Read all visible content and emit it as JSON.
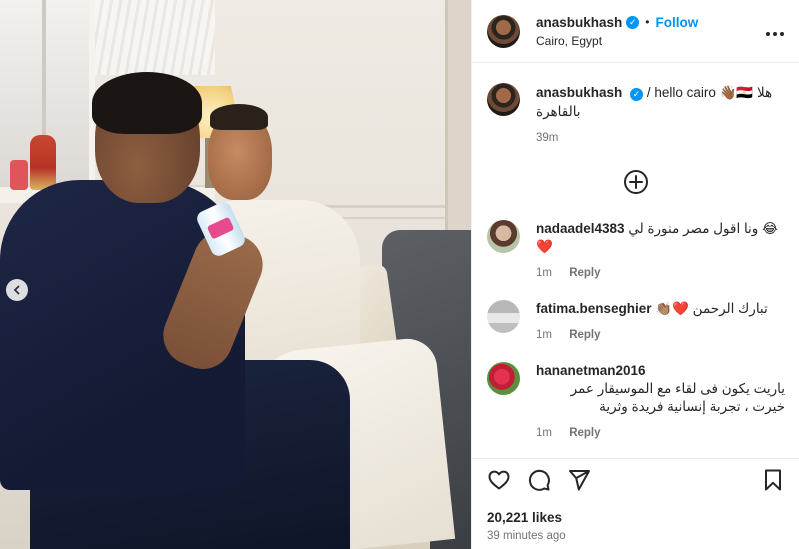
{
  "post": {
    "username": "anasbukhash",
    "verified_mark": "✓",
    "separator": "•",
    "follow_label": "Follow",
    "location": "Cairo, Egypt",
    "more_icon": "more-horizontal-icon",
    "carousel_icon": "chevron-left-icon"
  },
  "caption": {
    "username": "anasbukhash",
    "text": "/ hello cairo 👋🏾🇪🇬 هلا بالقاهرة",
    "time": "39m"
  },
  "add_comment_icon": "plus-circle-icon",
  "comments": [
    {
      "username": "nadaadel4383",
      "text": "😂 ونا اقول مصر منورة لي ❤️",
      "time": "1m",
      "reply": "Reply"
    },
    {
      "username": "fatima.benseghier",
      "text": "تبارك الرحمن ❤️👏🏽",
      "time": "1m",
      "reply": "Reply"
    },
    {
      "username": "hananetman2016",
      "text": "ياريت يكون فى لقاء مع الموسيقار عمر خيرت ، تجربة إنسانية فريدة وثرية",
      "time": "1m",
      "reply": "Reply"
    }
  ],
  "actions": {
    "like_icon": "heart-icon",
    "comment_icon": "comment-icon",
    "share_icon": "send-icon",
    "save_icon": "bookmark-icon"
  },
  "likes": "20,221 likes",
  "posted_ago": "39 minutes ago",
  "colors": {
    "accent": "#0095f6",
    "muted": "#737373",
    "text": "#262626"
  }
}
